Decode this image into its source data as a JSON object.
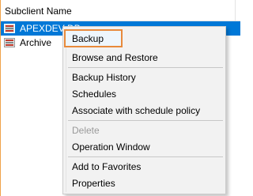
{
  "header": {
    "column_label": "Subclient Name"
  },
  "rows": [
    {
      "label": "APEXDEV-DB",
      "selected": true
    },
    {
      "label": "Archive",
      "selected": false
    }
  ],
  "context_menu": {
    "highlight_color": "#e88a3c",
    "items": [
      {
        "label": "Backup",
        "enabled": true,
        "highlighted": true
      },
      {
        "label": "Browse and Restore",
        "enabled": true
      },
      {
        "label": "Backup History",
        "enabled": true
      },
      {
        "label": "Schedules",
        "enabled": true
      },
      {
        "label": "Associate with schedule policy",
        "enabled": true
      },
      {
        "label": "Delete",
        "enabled": false
      },
      {
        "label": "Operation Window",
        "enabled": true
      },
      {
        "label": "Add to Favorites",
        "enabled": true
      },
      {
        "label": "Properties",
        "enabled": true
      }
    ]
  },
  "colors": {
    "selection": "#0078d7",
    "pane_accent": "#f0a24a"
  }
}
